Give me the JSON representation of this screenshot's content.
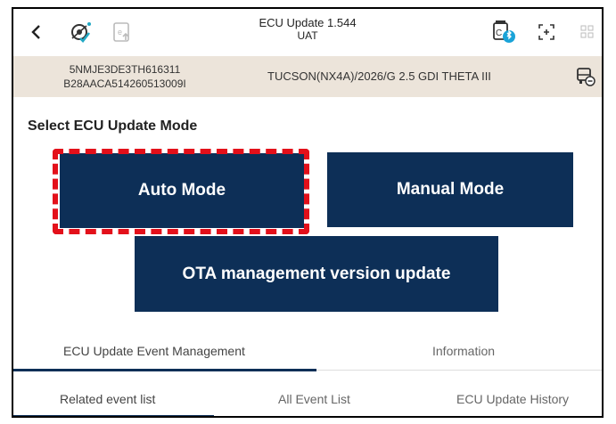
{
  "header": {
    "title": "ECU Update 1.544",
    "subtitle": "UAT",
    "icons": [
      "chevron-left-icon",
      "satellite-dish-icon",
      "ecu-upload-icon",
      "bluetooth-vci-icon",
      "expand-icon",
      "grid-icon"
    ]
  },
  "vehicle": {
    "vin": "5NMJE3DE3TH616311",
    "id": "B28AACA514260513009I",
    "model": "TUCSON(NX4A)/2026/G 2.5 GDI THETA III",
    "icon": "vehicle-status-icon"
  },
  "section_title": "Select ECU Update Mode",
  "modes": {
    "auto": "Auto Mode",
    "manual": "Manual Mode",
    "ota": "OTA management version update"
  },
  "tabs_primary": {
    "ecu_event_mgmt": "ECU Update Event Management",
    "information": "Information"
  },
  "tabs_secondary": {
    "related": "Related event list",
    "all": "All Event List",
    "history": "ECU Update History"
  },
  "colors": {
    "accent": "#0d2f57",
    "highlight": "#e3101a",
    "vehicle_bar": "#ece4da"
  }
}
